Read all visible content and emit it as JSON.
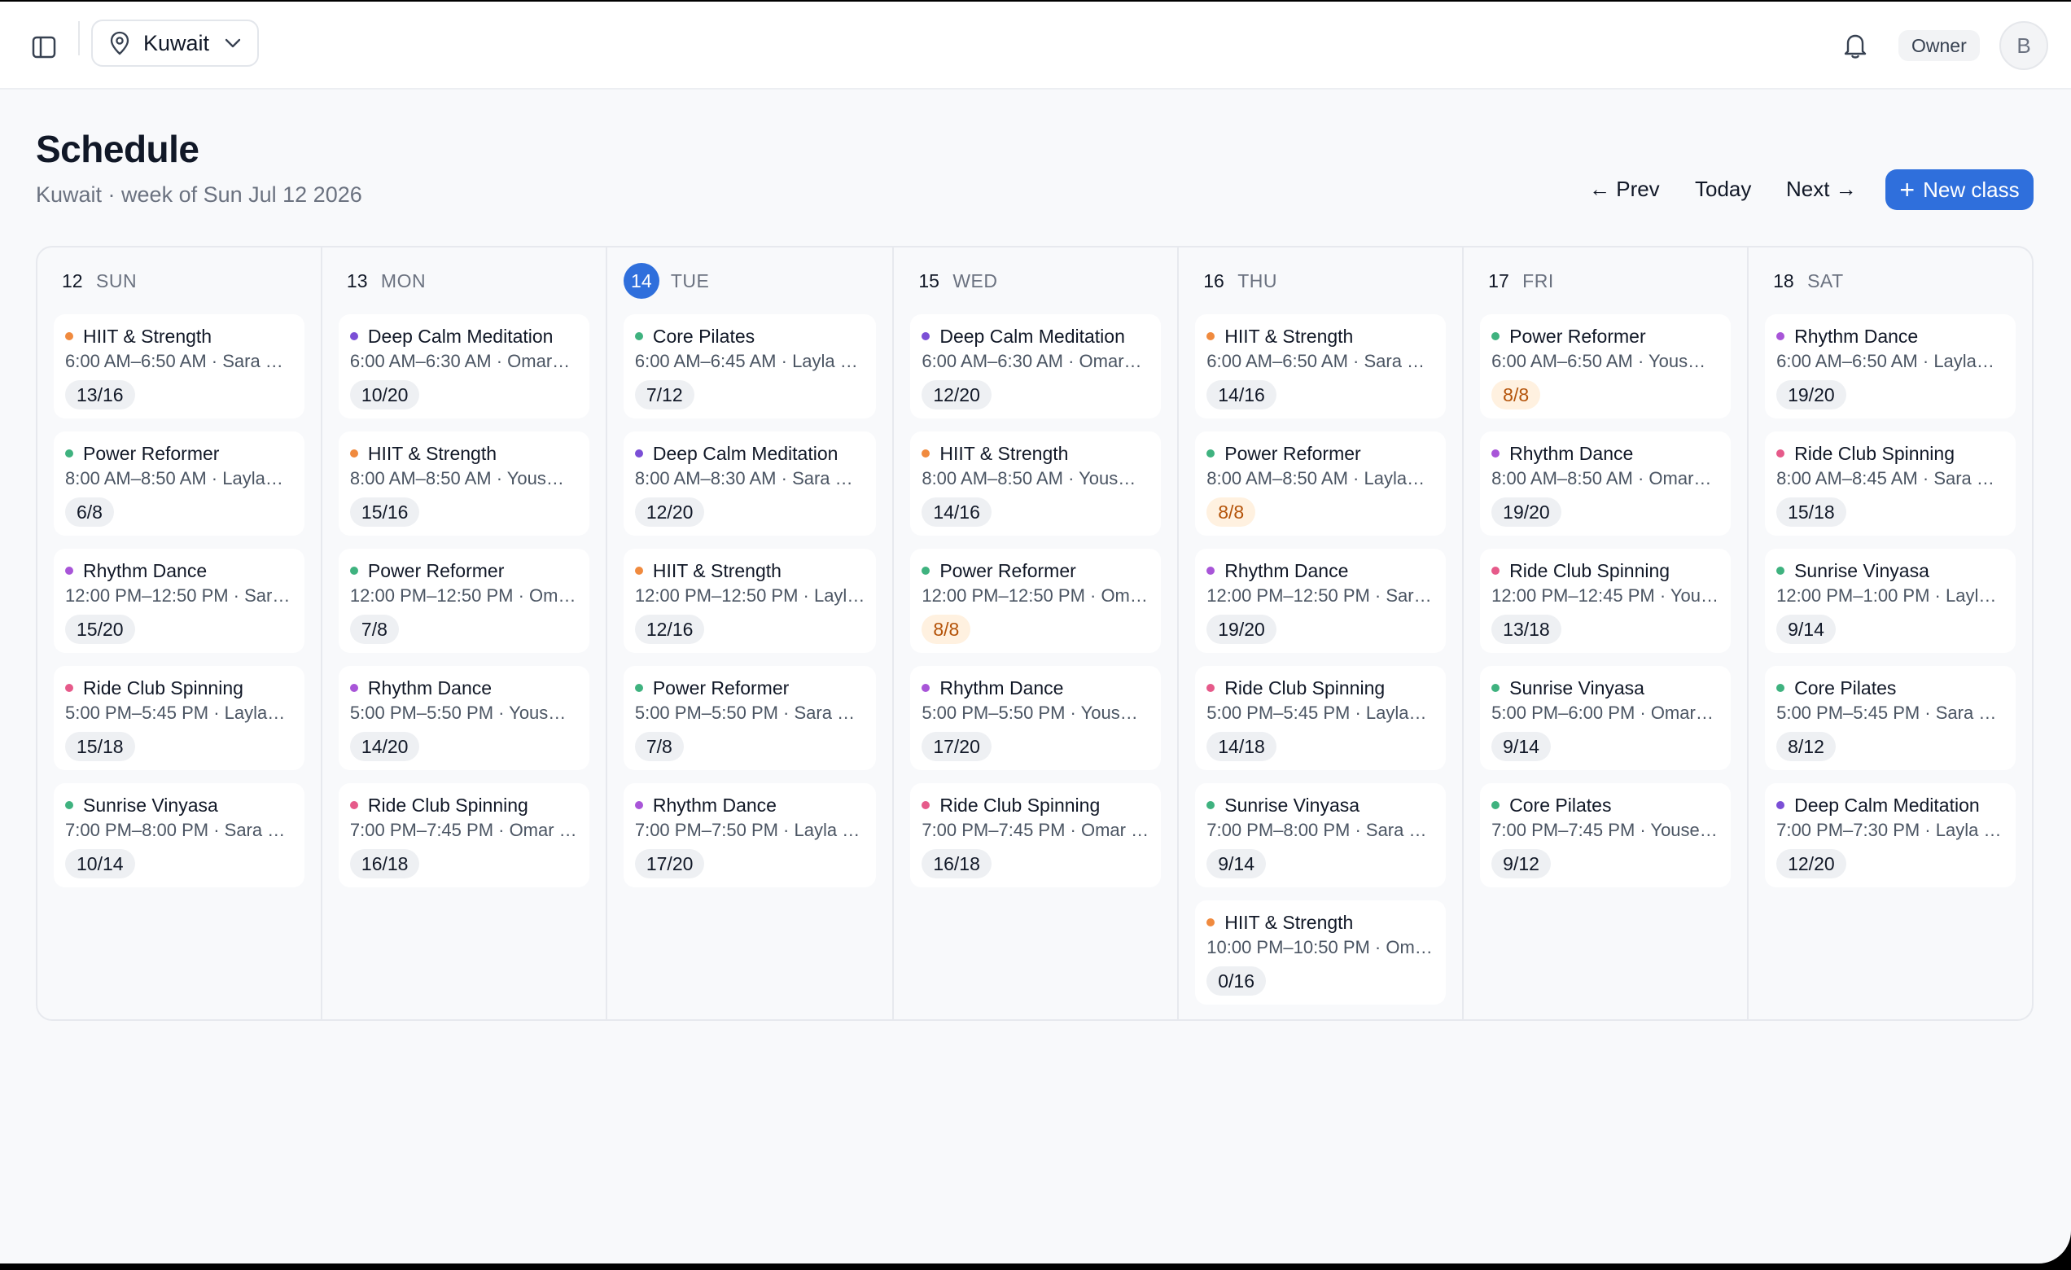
{
  "topbar": {
    "location": "Kuwait",
    "role": "Owner",
    "avatar_initial": "B"
  },
  "header": {
    "title": "Schedule",
    "subtitle": "Kuwait · week of Sun Jul 12 2026",
    "prev_label": "← Prev",
    "today_label": "Today",
    "next_label": "Next →",
    "new_class_label": "New class",
    "accent_color": "#2f6fdc"
  },
  "class_colors": {
    "HIIT & Strength": "#f08a3e",
    "Deep Calm Meditation": "#7b4fd6",
    "Core Pilates": "#3fb27f",
    "Power Reformer": "#3fb27f",
    "Rhythm Dance": "#a855d8",
    "Ride Club Spinning": "#e65a8a",
    "Sunrise Vinyasa": "#3fb27f"
  },
  "days": [
    {
      "num": "12",
      "name": "SUN",
      "today": false,
      "classes": [
        {
          "name": "HIIT & Strength",
          "meta": "6:00 AM–6:50 AM · Sara …",
          "cap": "13/16",
          "full": false
        },
        {
          "name": "Power Reformer",
          "meta": "8:00 AM–8:50 AM · Layla…",
          "cap": "6/8",
          "full": false
        },
        {
          "name": "Rhythm Dance",
          "meta": "12:00 PM–12:50 PM · Sar…",
          "cap": "15/20",
          "full": false
        },
        {
          "name": "Ride Club Spinning",
          "meta": "5:00 PM–5:45 PM · Layla…",
          "cap": "15/18",
          "full": false
        },
        {
          "name": "Sunrise Vinyasa",
          "meta": "7:00 PM–8:00 PM · Sara …",
          "cap": "10/14",
          "full": false
        }
      ]
    },
    {
      "num": "13",
      "name": "MON",
      "today": false,
      "classes": [
        {
          "name": "Deep Calm Meditation",
          "meta": "6:00 AM–6:30 AM · Omar…",
          "cap": "10/20",
          "full": false
        },
        {
          "name": "HIIT & Strength",
          "meta": "8:00 AM–8:50 AM · Yous…",
          "cap": "15/16",
          "full": false
        },
        {
          "name": "Power Reformer",
          "meta": "12:00 PM–12:50 PM · Om…",
          "cap": "7/8",
          "full": false
        },
        {
          "name": "Rhythm Dance",
          "meta": "5:00 PM–5:50 PM · Yous…",
          "cap": "14/20",
          "full": false
        },
        {
          "name": "Ride Club Spinning",
          "meta": "7:00 PM–7:45 PM · Omar …",
          "cap": "16/18",
          "full": false
        }
      ]
    },
    {
      "num": "14",
      "name": "TUE",
      "today": true,
      "classes": [
        {
          "name": "Core Pilates",
          "meta": "6:00 AM–6:45 AM · Layla …",
          "cap": "7/12",
          "full": false
        },
        {
          "name": "Deep Calm Meditation",
          "meta": "8:00 AM–8:30 AM · Sara …",
          "cap": "12/20",
          "full": false
        },
        {
          "name": "HIIT & Strength",
          "meta": "12:00 PM–12:50 PM · Layl…",
          "cap": "12/16",
          "full": false
        },
        {
          "name": "Power Reformer",
          "meta": "5:00 PM–5:50 PM · Sara …",
          "cap": "7/8",
          "full": false
        },
        {
          "name": "Rhythm Dance",
          "meta": "7:00 PM–7:50 PM · Layla …",
          "cap": "17/20",
          "full": false
        }
      ]
    },
    {
      "num": "15",
      "name": "WED",
      "today": false,
      "classes": [
        {
          "name": "Deep Calm Meditation",
          "meta": "6:00 AM–6:30 AM · Omar…",
          "cap": "12/20",
          "full": false
        },
        {
          "name": "HIIT & Strength",
          "meta": "8:00 AM–8:50 AM · Yous…",
          "cap": "14/16",
          "full": false
        },
        {
          "name": "Power Reformer",
          "meta": "12:00 PM–12:50 PM · Om…",
          "cap": "8/8",
          "full": true
        },
        {
          "name": "Rhythm Dance",
          "meta": "5:00 PM–5:50 PM · Yous…",
          "cap": "17/20",
          "full": false
        },
        {
          "name": "Ride Club Spinning",
          "meta": "7:00 PM–7:45 PM · Omar …",
          "cap": "16/18",
          "full": false
        }
      ]
    },
    {
      "num": "16",
      "name": "THU",
      "today": false,
      "classes": [
        {
          "name": "HIIT & Strength",
          "meta": "6:00 AM–6:50 AM · Sara …",
          "cap": "14/16",
          "full": false
        },
        {
          "name": "Power Reformer",
          "meta": "8:00 AM–8:50 AM · Layla…",
          "cap": "8/8",
          "full": true
        },
        {
          "name": "Rhythm Dance",
          "meta": "12:00 PM–12:50 PM · Sar…",
          "cap": "19/20",
          "full": false
        },
        {
          "name": "Ride Club Spinning",
          "meta": "5:00 PM–5:45 PM · Layla…",
          "cap": "14/18",
          "full": false
        },
        {
          "name": "Sunrise Vinyasa",
          "meta": "7:00 PM–8:00 PM · Sara …",
          "cap": "9/14",
          "full": false
        },
        {
          "name": "HIIT & Strength",
          "meta": "10:00 PM–10:50 PM · Om…",
          "cap": "0/16",
          "full": false
        }
      ]
    },
    {
      "num": "17",
      "name": "FRI",
      "today": false,
      "classes": [
        {
          "name": "Power Reformer",
          "meta": "6:00 AM–6:50 AM · Yous…",
          "cap": "8/8",
          "full": true
        },
        {
          "name": "Rhythm Dance",
          "meta": "8:00 AM–8:50 AM · Omar…",
          "cap": "19/20",
          "full": false
        },
        {
          "name": "Ride Club Spinning",
          "meta": "12:00 PM–12:45 PM · You…",
          "cap": "13/18",
          "full": false
        },
        {
          "name": "Sunrise Vinyasa",
          "meta": "5:00 PM–6:00 PM · Omar…",
          "cap": "9/14",
          "full": false
        },
        {
          "name": "Core Pilates",
          "meta": "7:00 PM–7:45 PM · Youse…",
          "cap": "9/12",
          "full": false
        }
      ]
    },
    {
      "num": "18",
      "name": "SAT",
      "today": false,
      "classes": [
        {
          "name": "Rhythm Dance",
          "meta": "6:00 AM–6:50 AM · Layla…",
          "cap": "19/20",
          "full": false
        },
        {
          "name": "Ride Club Spinning",
          "meta": "8:00 AM–8:45 AM · Sara …",
          "cap": "15/18",
          "full": false
        },
        {
          "name": "Sunrise Vinyasa",
          "meta": "12:00 PM–1:00 PM · Layl…",
          "cap": "9/14",
          "full": false
        },
        {
          "name": "Core Pilates",
          "meta": "5:00 PM–5:45 PM · Sara …",
          "cap": "8/12",
          "full": false
        },
        {
          "name": "Deep Calm Meditation",
          "meta": "7:00 PM–7:30 PM · Layla …",
          "cap": "12/20",
          "full": false
        }
      ]
    }
  ]
}
